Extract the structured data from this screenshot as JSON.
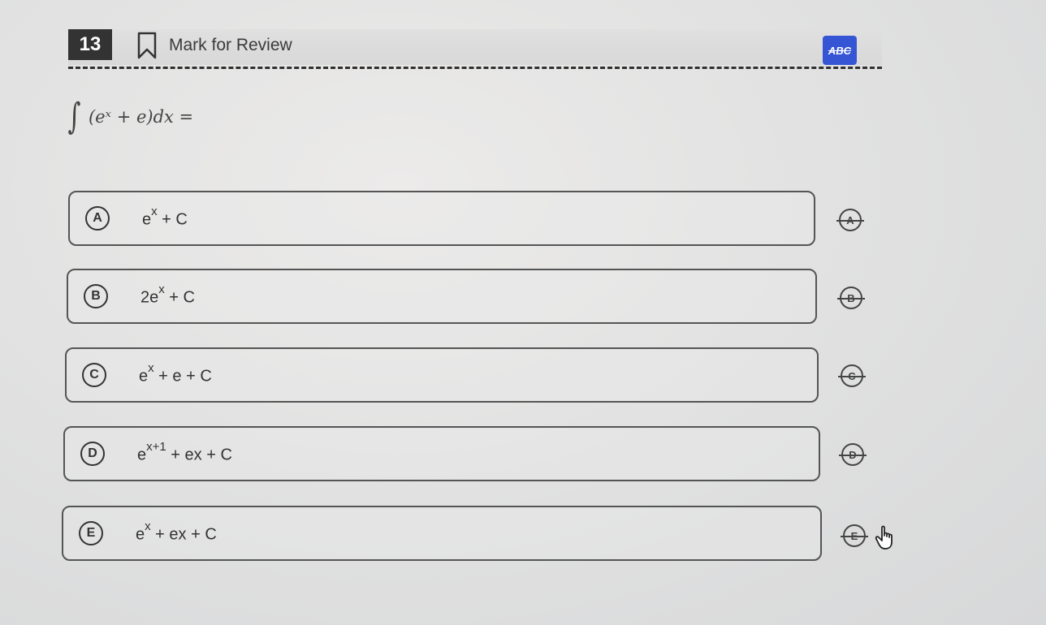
{
  "header": {
    "question_number": "13",
    "mark_review_label": "Mark for Review",
    "abc_button_label": "ABC"
  },
  "question": {
    "integral_sign": "∫",
    "prompt": "(eˣ + e)dx ="
  },
  "choices": [
    {
      "letter": "A",
      "base": "e",
      "sup": "x",
      "rest": " + C"
    },
    {
      "letter": "B",
      "base": "2e",
      "sup": "x",
      "rest": " + C"
    },
    {
      "letter": "C",
      "base": "e",
      "sup": "x",
      "rest": " + e + C"
    },
    {
      "letter": "D",
      "base": "e",
      "sup": "x+1",
      "rest": " + ex + C"
    },
    {
      "letter": "E",
      "base": "e",
      "sup": "x",
      "rest": " + ex + C"
    }
  ],
  "icons": {
    "bookmark": "bookmark-icon",
    "eliminate": "strikethrough-option-icon",
    "cursor": "hand-pointer-icon"
  },
  "colors": {
    "question_number_bg": "#333333",
    "abc_button_bg": "#3555d4",
    "border": "#555555"
  }
}
